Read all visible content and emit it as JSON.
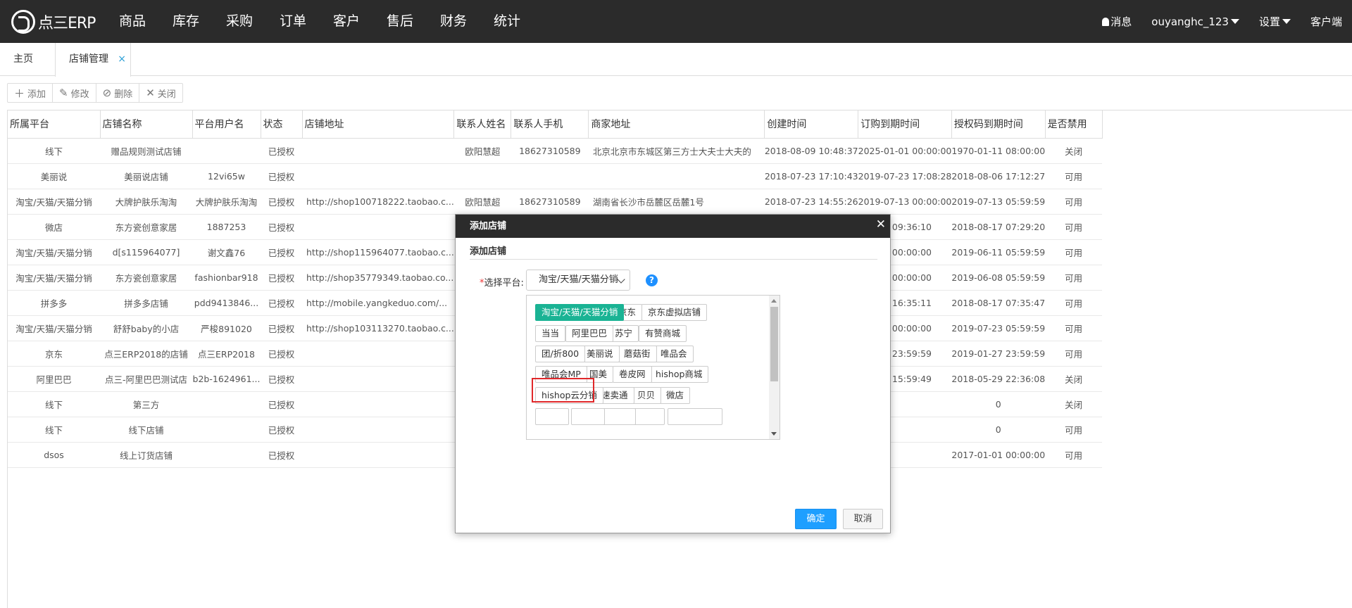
{
  "nav": {
    "logo_text": "点三ERP",
    "menu": [
      "商品",
      "库存",
      "采购",
      "订单",
      "客户",
      "售后",
      "财务",
      "统计"
    ],
    "messages": "消息",
    "username": "ouyanghc_123",
    "settings": "设置",
    "client": "客户端"
  },
  "tabs": {
    "home": "主页",
    "shop_mgmt": "店铺管理",
    "close": "×"
  },
  "toolbar": {
    "add": "添加",
    "edit": "修改",
    "delete": "删除",
    "close": "关闭"
  },
  "table": {
    "headers": [
      "所属平台",
      "店铺名称",
      "平台用户名",
      "状态",
      "店铺地址",
      "联系人姓名",
      "联系人手机",
      "商家地址",
      "创建时间",
      "订购到期时间",
      "授权码到期时间",
      "是否禁用"
    ],
    "rows": [
      [
        "线下",
        "赠品规则测试店铺",
        "",
        "已授权",
        "",
        "欧阳慧超",
        "18627310589",
        "北京北京市东城区第三方士大夫士大夫的",
        "2018-08-09 10:48:37",
        "2025-01-01 00:00:00",
        "1970-01-11 08:00:00",
        "关闭"
      ],
      [
        "美丽说",
        "美丽说店铺",
        "12vi65w",
        "已授权",
        "",
        "",
        "",
        "",
        "2018-07-23 17:10:43",
        "2019-07-23 17:08:28",
        "2018-08-06 17:12:27",
        "可用"
      ],
      [
        "淘宝/天猫/天猫分销",
        "大牌护肤乐淘淘",
        "大牌护肤乐淘淘",
        "已授权",
        "http://shop100718222.taobao.c...",
        "欧阳慧超",
        "18627310589",
        "湖南省长沙市岳麓区岳麓1号",
        "2018-07-23 14:55:26",
        "2019-07-13 00:00:00",
        "2019-07-13 05:59:59",
        "可用"
      ],
      [
        "微店",
        "东方瓷创意家居",
        "1887253",
        "已授权",
        "",
        "",
        "",
        "",
        "",
        "14 09:36:10",
        "2018-08-17 07:29:20",
        "可用"
      ],
      [
        "淘宝/天猫/天猫分销",
        "d[s115964077]",
        "谢文鑫76",
        "已授权",
        "http://shop115964077.taobao.c...",
        "",
        "",
        "",
        "",
        "11 00:00:00",
        "2019-06-11 05:59:59",
        "可用"
      ],
      [
        "淘宝/天猫/天猫分销",
        "东方瓷创意家居",
        "fashionbar918",
        "已授权",
        "http://shop35779349.taobao.co...",
        "",
        "",
        "",
        "",
        "08 00:00:00",
        "2019-06-08 05:59:59",
        "可用"
      ],
      [
        "拼多多",
        "拼多多店铺",
        "pdd9413846...",
        "已授权",
        "http://mobile.yangkeduo.com/...",
        "",
        "",
        "",
        "",
        "31 16:35:11",
        "2018-08-17 07:35:47",
        "可用"
      ],
      [
        "淘宝/天猫/天猫分销",
        "舒舒baby的小店",
        "严梭891020",
        "已授权",
        "http://shop103113270.taobao.c...",
        "",
        "",
        "",
        "",
        "16 00:00:00",
        "2019-07-23 05:59:59",
        "可用"
      ],
      [
        "京东",
        "点三ERP2018的店铺",
        "点三ERP2018",
        "已授权",
        "",
        "",
        "",
        "",
        "",
        "27 23:59:59",
        "2019-01-27 23:59:59",
        "可用"
      ],
      [
        "阿里巴巴",
        "点三-阿里巴巴测试店",
        "b2b-1624961...",
        "已授权",
        "",
        "",
        "",
        "",
        "",
        "05 15:59:49",
        "2018-05-29 22:36:08",
        "关闭"
      ],
      [
        "线下",
        "第三方",
        "",
        "已授权",
        "",
        "",
        "",
        "",
        "",
        "",
        "0",
        "关闭"
      ],
      [
        "线下",
        "线下店铺",
        "",
        "已授权",
        "",
        "",
        "",
        "",
        "",
        "",
        "0",
        "可用"
      ],
      [
        "dsos",
        "线上订货店铺",
        "",
        "已授权",
        "",
        "",
        "",
        "",
        "",
        "",
        "2017-01-01 00:00:00",
        "可用"
      ]
    ]
  },
  "modal": {
    "title": "添加店铺",
    "subtitle": "添加店铺",
    "platform_label": "选择平台:",
    "required_mark": "*",
    "selected_platform": "淘宝/天猫/天猫分销",
    "help": "?",
    "platforms": [
      [
        "淘宝/天猫/天猫分销",
        "京东",
        "京东虚拟店铺"
      ],
      [
        "当当",
        "阿里巴巴",
        "苏宁",
        "有赞商城"
      ],
      [
        "团/折800",
        "美丽说",
        "蘑菇街",
        "唯品会"
      ],
      [
        "唯品会MP",
        "国美",
        "卷皮网",
        "hishop商城"
      ],
      [
        "hishop云分销",
        "速卖通",
        "贝贝",
        "微店"
      ]
    ],
    "active_platform": "淘宝/天猫/天猫分销",
    "highlighted_platform": "唯品会MP",
    "ok": "确定",
    "cancel": "取消"
  }
}
